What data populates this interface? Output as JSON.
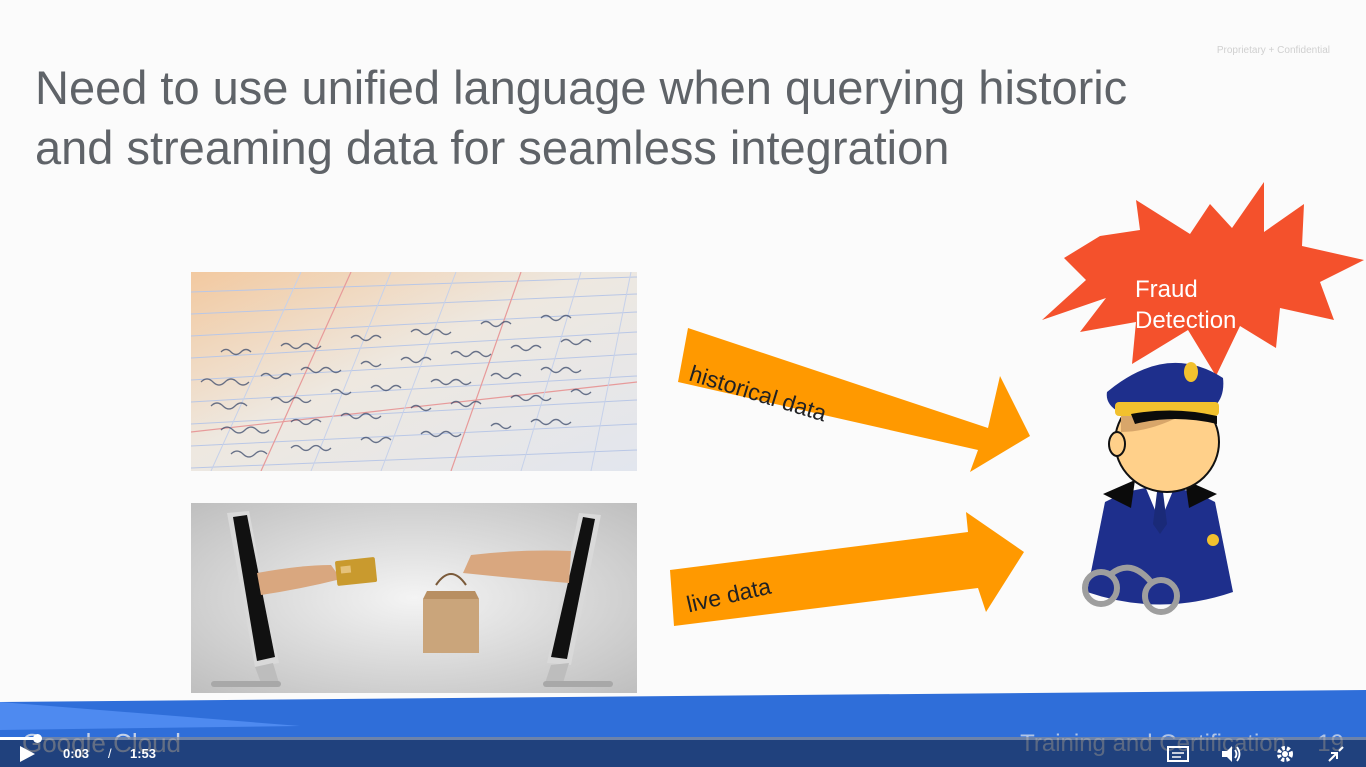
{
  "slide": {
    "confidential_label": "Proprietary + Confidential",
    "title_line1": "Need to use unified language when querying historic",
    "title_line2": "and streaming data for seamless integration",
    "arrow_historical_label": "historical data",
    "arrow_live_label": "live data",
    "fraud_line1": "Fraud",
    "fraud_line2": "Detection",
    "footer_brand": "Google Cloud",
    "footer_training": "Training and Certification",
    "footer_slide_number": "19"
  },
  "colors": {
    "arrow_orange": "#ff9900",
    "burst_red": "#f4512c",
    "footer_blue": "#2f6ed9",
    "title_gray": "#5f6368"
  },
  "player": {
    "current_time": "0:03",
    "separator": "/",
    "total_time": "1:53",
    "progress_fraction": 0.027,
    "icons": [
      "play-icon",
      "captions-icon",
      "volume-icon",
      "settings-icon",
      "exit-fullscreen-icon"
    ]
  }
}
